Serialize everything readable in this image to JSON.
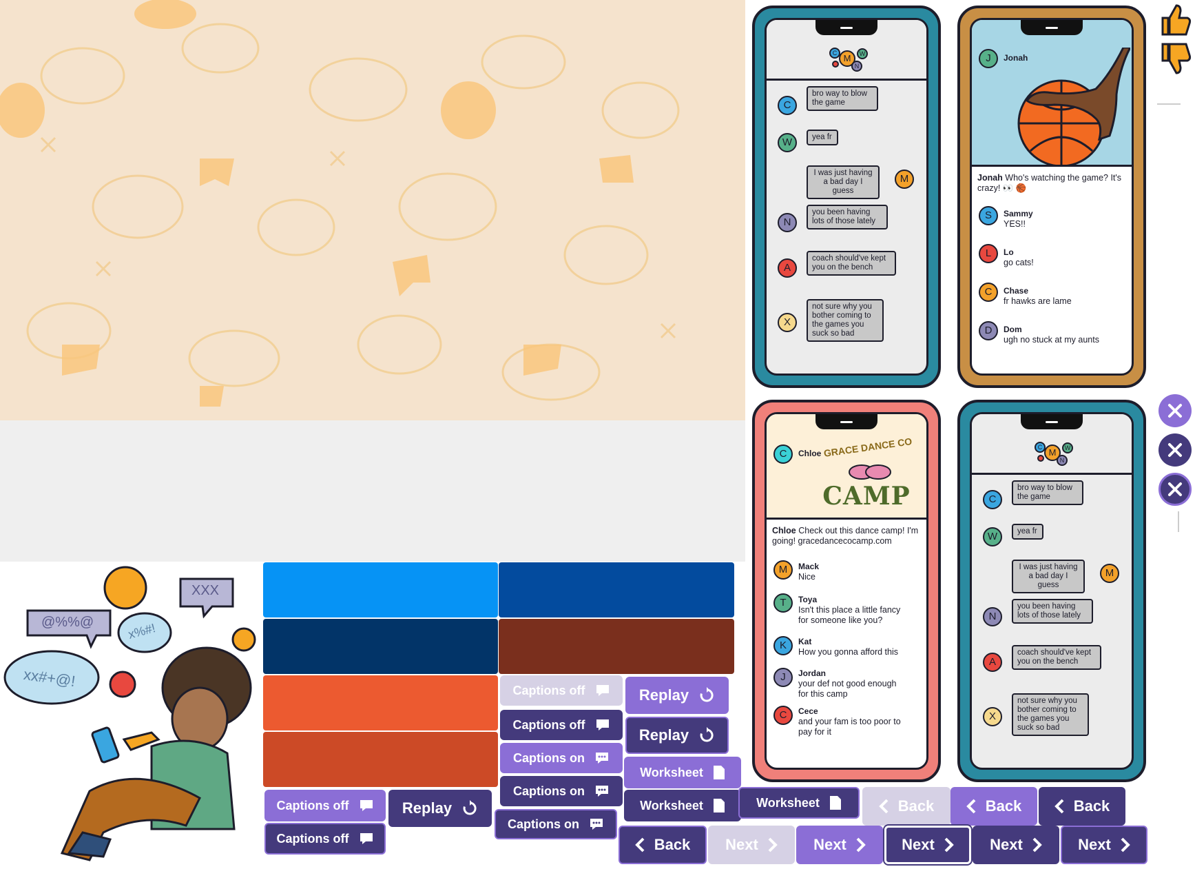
{
  "phone_chat_1": {
    "topbar_avatars": [
      "C",
      "M",
      "W",
      "N",
      "A"
    ],
    "messages": [
      {
        "avatar": "C",
        "color": "#3aa6e0",
        "side": "left",
        "text": "bro way to blow the game"
      },
      {
        "avatar": "W",
        "color": "#57b089",
        "side": "left",
        "text": "yea fr"
      },
      {
        "avatar": "M",
        "color": "#f3a12a",
        "side": "right",
        "text": "I was just having a bad day I guess"
      },
      {
        "avatar": "N",
        "color": "#8d89b5",
        "side": "left",
        "text": "you been having lots of those lately"
      },
      {
        "avatar": "A",
        "color": "#e8483f",
        "side": "left",
        "text": "coach should've kept you on the bench"
      },
      {
        "avatar": "X",
        "color": "#f6d98d",
        "side": "left",
        "text": "not sure why you bother coming to the games you suck so bad"
      }
    ]
  },
  "phone_jonah": {
    "poster": "Jonah",
    "post_name": "Jonah",
    "post_text": "Who's watching the game? It's crazy! 👀 🏀",
    "comments": [
      {
        "avatar": "S",
        "color": "#3aa6e0",
        "name": "Sammy",
        "text": "YES!!"
      },
      {
        "avatar": "L",
        "color": "#e8483f",
        "name": "Lo",
        "text": "go cats!"
      },
      {
        "avatar": "C",
        "color": "#f3a12a",
        "name": "Chase",
        "text": "fr hawks are lame"
      },
      {
        "avatar": "D",
        "color": "#8d89b5",
        "name": "Dom",
        "text": "ugh no stuck at my aunts"
      }
    ]
  },
  "phone_chloe": {
    "poster": "Chloe",
    "logo_line1": "GRACE DANCE CO",
    "logo_line2": "CAMP",
    "post_name": "Chloe",
    "post_text": "Check out this dance camp! I'm going! gracedancecocamp.com",
    "comments": [
      {
        "avatar": "M",
        "color": "#f3a12a",
        "name": "Mack",
        "text": "Nice"
      },
      {
        "avatar": "T",
        "color": "#57b089",
        "name": "Toya",
        "text": "Isn't this place a little fancy for someone like you?"
      },
      {
        "avatar": "K",
        "color": "#3aa6e0",
        "name": "Kat",
        "text": "How you gonna afford this"
      },
      {
        "avatar": "J",
        "color": "#8d89b5",
        "name": "Jordan",
        "text": "your def not good enough for this camp"
      },
      {
        "avatar": "C",
        "color": "#e8483f",
        "name": "Cece",
        "text": "and your fam is too poor to pay for it"
      }
    ]
  },
  "phone_chat_2": {
    "topbar_avatars": [
      "C",
      "M",
      "W",
      "N",
      "A"
    ],
    "messages": [
      {
        "avatar": "C",
        "color": "#3aa6e0",
        "side": "left",
        "text": "bro way to blow the game"
      },
      {
        "avatar": "W",
        "color": "#57b089",
        "side": "left",
        "text": "yea fr"
      },
      {
        "avatar": "M",
        "color": "#f3a12a",
        "side": "right",
        "text": "I was just having a bad day I guess"
      },
      {
        "avatar": "N",
        "color": "#8d89b5",
        "side": "left",
        "text": "you been having lots of those lately"
      },
      {
        "avatar": "A",
        "color": "#e8483f",
        "side": "left",
        "text": "coach should've kept you on the bench"
      },
      {
        "avatar": "X",
        "color": "#f6d98d",
        "side": "left",
        "text": "not sure why you bother coming to the games you suck so bad"
      }
    ]
  },
  "sticker_bubbles": [
    "XXX",
    "@%%@",
    "x%#!",
    "xx#+@!"
  ],
  "swatches": [
    "#0693f5",
    "#034b9e",
    "#023468",
    "#7a2f1d",
    "#ec5a30",
    "#cc4a26"
  ],
  "buttons": {
    "captions_off": "Captions off",
    "captions_on": "Captions on",
    "replay": "Replay",
    "worksheet": "Worksheet",
    "back": "Back",
    "next": "Next"
  },
  "colors": {
    "lavender": "#8b6ed6",
    "dark_purple": "#443a7c",
    "disabled": "#d6d1e5",
    "thumbs": "#f6a623"
  }
}
